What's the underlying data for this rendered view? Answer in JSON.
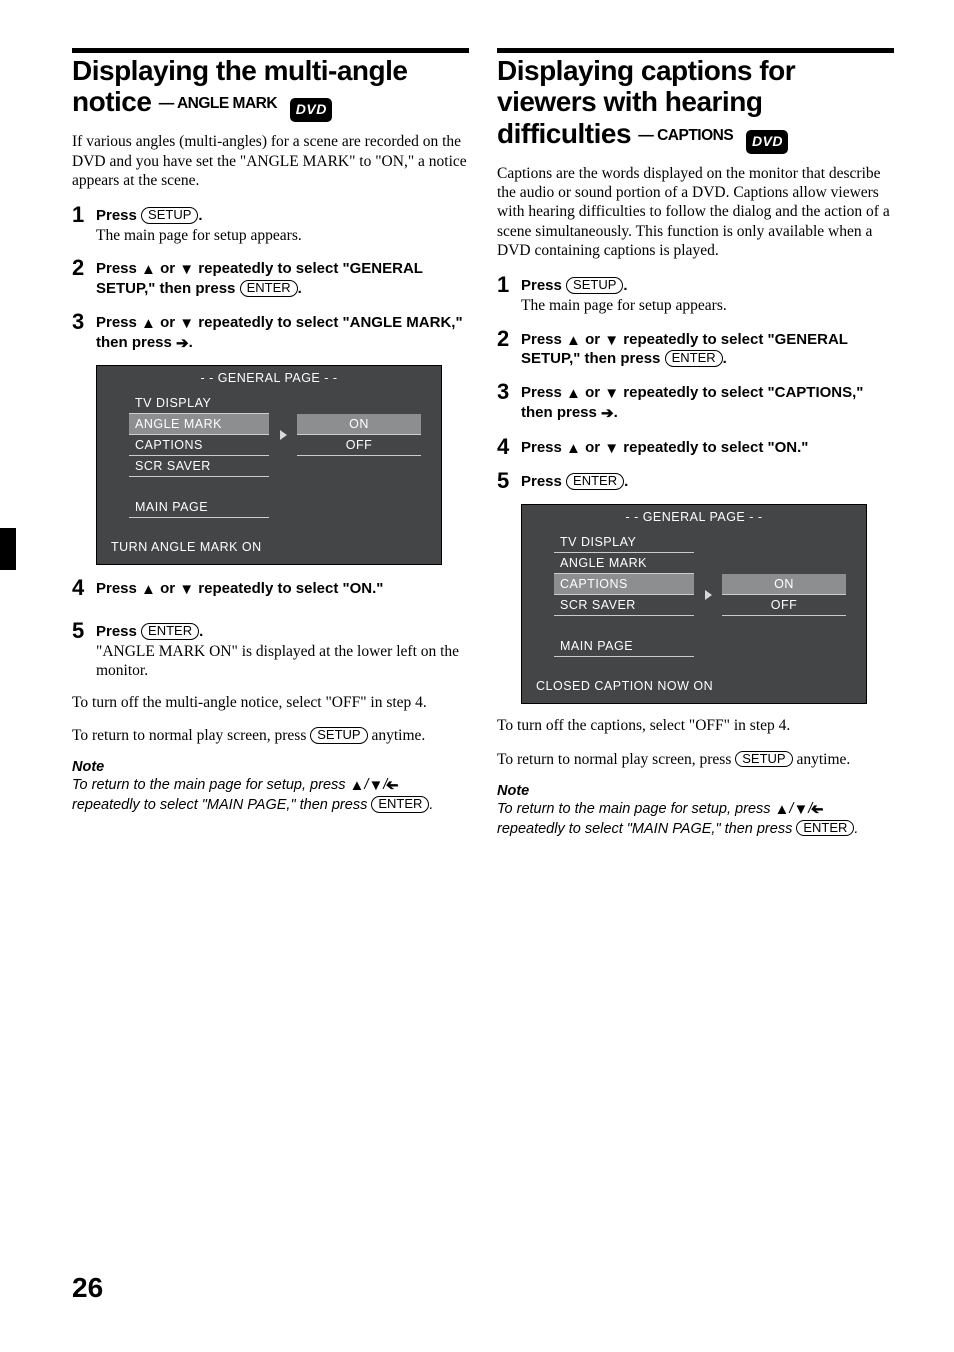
{
  "pageNumber": "26",
  "left": {
    "title_l1": "Displaying the multi-angle",
    "title_l2": "notice",
    "subtitle": "— ANGLE MARK",
    "dvdBadge": "DVD",
    "intro": "If various angles (multi-angles) for a scene are recorded on the DVD and you have set the \"ANGLE MARK\" to \"ON,\" a notice appears at the scene.",
    "steps": [
      {
        "num": "1",
        "head_pre": "Press ",
        "btn": "SETUP",
        "head_post": ".",
        "text": "The main page for setup appears."
      },
      {
        "num": "2",
        "head_pre": "Press ",
        "head_mid": " or ",
        "head_post": " repeatedly to select \"GENERAL SETUP,\" then press ",
        "btn": "ENTER",
        "head_end": "."
      },
      {
        "num": "3",
        "head_pre": "Press ",
        "head_mid": " or ",
        "head_post": " repeatedly to select \"ANGLE MARK,\" then press ",
        "arrow_right": true,
        "head_end": "."
      },
      {
        "num": "4",
        "head_pre": "Press ",
        "head_mid": " or ",
        "head_post": " repeatedly to select \"ON.\""
      },
      {
        "num": "5",
        "head_pre": "Press ",
        "btn": "ENTER",
        "head_post": ".",
        "text": "\"ANGLE MARK ON\" is displayed at the lower left on the monitor."
      }
    ],
    "panel": {
      "title": "- - GENERAL PAGE - -",
      "items": [
        "TV DISPLAY",
        "ANGLE MARK",
        "CAPTIONS",
        "SCR SAVER"
      ],
      "mainPage": "MAIN PAGE",
      "selectedIndex": 1,
      "options": [
        "ON",
        "OFF"
      ],
      "selectedOption": 0,
      "status": "TURN ANGLE MARK ON"
    },
    "afterPanelStep": 3,
    "para1": "To turn off the multi-angle notice, select \"OFF\" in step 4.",
    "para2_pre": "To return to normal play screen, press ",
    "para2_btn": "SETUP",
    "para2_post": " anytime.",
    "noteHead": "Note",
    "note_pre": "To return to the main page for setup, press ",
    "note_mid": " repeatedly to select \"MAIN PAGE,\" then press ",
    "note_btn": "ENTER",
    "note_post": "."
  },
  "right": {
    "title_l1": "Displaying captions for",
    "title_l2": "viewers with hearing",
    "title_l3": "difficulties",
    "subtitle": "— CAPTIONS",
    "dvdBadge": "DVD",
    "intro": "Captions are the words displayed on the monitor that describe the audio or sound portion of a DVD. Captions allow viewers with hearing difficulties to follow the dialog and the action of a scene simultaneously. This function is only available when a DVD containing captions is played.",
    "steps": [
      {
        "num": "1",
        "head_pre": "Press ",
        "btn": "SETUP",
        "head_post": ".",
        "text": "The main page for setup appears."
      },
      {
        "num": "2",
        "head_pre": "Press ",
        "head_mid": " or ",
        "head_post": " repeatedly to select \"GENERAL SETUP,\" then press ",
        "btn": "ENTER",
        "head_end": "."
      },
      {
        "num": "3",
        "head_pre": "Press ",
        "head_mid": " or ",
        "head_post": " repeatedly to select \"CAPTIONS,\" then press ",
        "arrow_right": true,
        "head_end": "."
      },
      {
        "num": "4",
        "head_pre": "Press ",
        "head_mid": " or ",
        "head_post": " repeatedly to select \"ON.\""
      },
      {
        "num": "5",
        "head_pre": "Press ",
        "btn": "ENTER",
        "head_post": "."
      }
    ],
    "panel": {
      "title": "- - GENERAL PAGE - -",
      "items": [
        "TV DISPLAY",
        "ANGLE MARK",
        "CAPTIONS",
        "SCR SAVER"
      ],
      "mainPage": "MAIN PAGE",
      "selectedIndex": 2,
      "options": [
        "ON",
        "OFF"
      ],
      "selectedOption": 0,
      "status": "CLOSED CAPTION NOW ON"
    },
    "para1": "To turn off the captions, select \"OFF\" in step 4.",
    "para2_pre": "To return to normal play screen, press ",
    "para2_btn": "SETUP",
    "para2_post": " anytime.",
    "noteHead": "Note",
    "note_pre": "To return to the main page for setup, press ",
    "note_mid": " repeatedly to select \"MAIN PAGE,\" then press ",
    "note_btn": "ENTER",
    "note_post": "."
  }
}
